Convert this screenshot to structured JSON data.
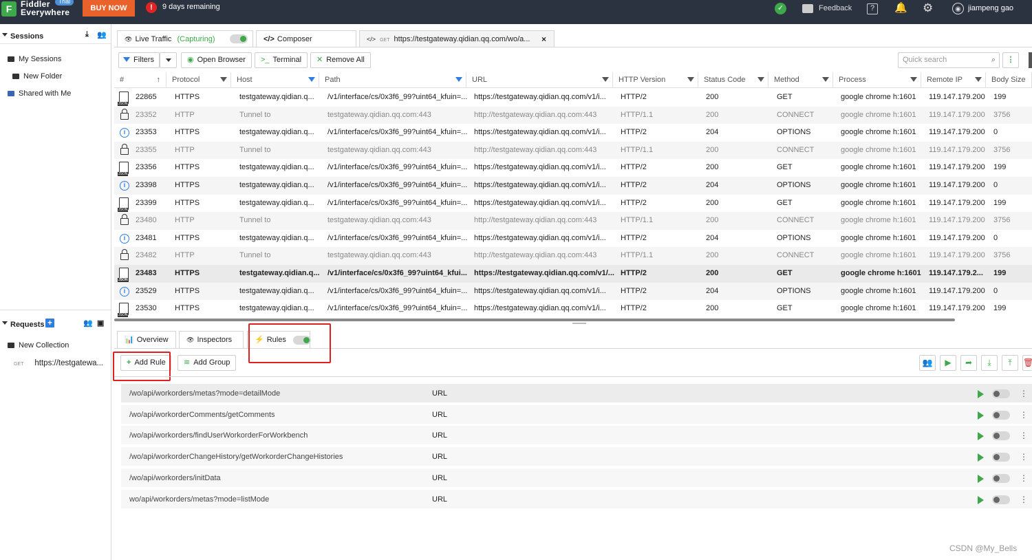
{
  "topbar": {
    "app_name_line1": "Fiddler",
    "app_name_line2": "Everywhere",
    "trial_badge": "Trial",
    "buy_now": "BUY NOW",
    "remaining": "9 days remaining",
    "feedback": "Feedback",
    "user": "jiampeng gao"
  },
  "sidebar": {
    "sessions_title": "Sessions",
    "my_sessions": "My Sessions",
    "new_folder": "New Folder",
    "shared_with_me": "Shared with Me",
    "requests_title": "Requests",
    "new_collection": "New Collection",
    "request_method": "GET",
    "request_url": "https://testgatewa..."
  },
  "tabs": {
    "live_traffic": "Live Traffic",
    "capturing": "(Capturing)",
    "composer": "Composer",
    "get_badge": "GET",
    "get_url": "https://testgateway.qidian.qq.com/wo/a..."
  },
  "toolbar": {
    "filters": "Filters",
    "open_browser": "Open Browser",
    "terminal": "Terminal",
    "remove_all": "Remove All",
    "search_placeholder": "Quick search"
  },
  "columns": [
    "#",
    "Protocol",
    "Host",
    "Path",
    "URL",
    "HTTP Version",
    "Status Code",
    "Method",
    "Process",
    "Remote IP",
    "Body Size"
  ],
  "sessions": [
    {
      "icon": "json",
      "id": "22865",
      "protocol": "HTTPS",
      "host": "testgateway.qidian.q...",
      "path": "/v1/interface/cs/0x3f6_99?uint64_kfuin=...",
      "url": "https://testgateway.qidian.qq.com/v1/i...",
      "version": "HTTP/2",
      "status": "200",
      "method": "GET",
      "process": "google chrome h:1601",
      "ip": "119.147.179.200",
      "size": "199"
    },
    {
      "icon": "lock",
      "id": "23352",
      "protocol": "HTTP",
      "host": "Tunnel to",
      "path": "testgateway.qidian.qq.com:443",
      "url": "http://testgateway.qidian.qq.com:443",
      "version": "HTTP/1.1",
      "status": "200",
      "method": "CONNECT",
      "process": "google chrome h:1601",
      "ip": "119.147.179.200",
      "size": "3756"
    },
    {
      "icon": "info",
      "id": "23353",
      "protocol": "HTTPS",
      "host": "testgateway.qidian.q...",
      "path": "/v1/interface/cs/0x3f6_99?uint64_kfuin=...",
      "url": "https://testgateway.qidian.qq.com/v1/i...",
      "version": "HTTP/2",
      "status": "204",
      "method": "OPTIONS",
      "process": "google chrome h:1601",
      "ip": "119.147.179.200",
      "size": "0"
    },
    {
      "icon": "lock",
      "id": "23355",
      "protocol": "HTTP",
      "host": "Tunnel to",
      "path": "testgateway.qidian.qq.com:443",
      "url": "http://testgateway.qidian.qq.com:443",
      "version": "HTTP/1.1",
      "status": "200",
      "method": "CONNECT",
      "process": "google chrome h:1601",
      "ip": "119.147.179.200",
      "size": "3756"
    },
    {
      "icon": "json",
      "id": "23356",
      "protocol": "HTTPS",
      "host": "testgateway.qidian.q...",
      "path": "/v1/interface/cs/0x3f6_99?uint64_kfuin=...",
      "url": "https://testgateway.qidian.qq.com/v1/i...",
      "version": "HTTP/2",
      "status": "200",
      "method": "GET",
      "process": "google chrome h:1601",
      "ip": "119.147.179.200",
      "size": "199"
    },
    {
      "icon": "info",
      "id": "23398",
      "protocol": "HTTPS",
      "host": "testgateway.qidian.q...",
      "path": "/v1/interface/cs/0x3f6_99?uint64_kfuin=...",
      "url": "https://testgateway.qidian.qq.com/v1/i...",
      "version": "HTTP/2",
      "status": "204",
      "method": "OPTIONS",
      "process": "google chrome h:1601",
      "ip": "119.147.179.200",
      "size": "0"
    },
    {
      "icon": "json",
      "id": "23399",
      "protocol": "HTTPS",
      "host": "testgateway.qidian.q...",
      "path": "/v1/interface/cs/0x3f6_99?uint64_kfuin=...",
      "url": "https://testgateway.qidian.qq.com/v1/i...",
      "version": "HTTP/2",
      "status": "200",
      "method": "GET",
      "process": "google chrome h:1601",
      "ip": "119.147.179.200",
      "size": "199"
    },
    {
      "icon": "lock",
      "id": "23480",
      "protocol": "HTTP",
      "host": "Tunnel to",
      "path": "testgateway.qidian.qq.com:443",
      "url": "http://testgateway.qidian.qq.com:443",
      "version": "HTTP/1.1",
      "status": "200",
      "method": "CONNECT",
      "process": "google chrome h:1601",
      "ip": "119.147.179.200",
      "size": "3756"
    },
    {
      "icon": "info",
      "id": "23481",
      "protocol": "HTTPS",
      "host": "testgateway.qidian.q...",
      "path": "/v1/interface/cs/0x3f6_99?uint64_kfuin=...",
      "url": "https://testgateway.qidian.qq.com/v1/i...",
      "version": "HTTP/2",
      "status": "204",
      "method": "OPTIONS",
      "process": "google chrome h:1601",
      "ip": "119.147.179.200",
      "size": "0"
    },
    {
      "icon": "lock",
      "id": "23482",
      "protocol": "HTTP",
      "host": "Tunnel to",
      "path": "testgateway.qidian.qq.com:443",
      "url": "http://testgateway.qidian.qq.com:443",
      "version": "HTTP/1.1",
      "status": "200",
      "method": "CONNECT",
      "process": "google chrome h:1601",
      "ip": "119.147.179.200",
      "size": "3756"
    },
    {
      "icon": "json",
      "id": "23483",
      "protocol": "HTTPS",
      "host": "testgateway.qidian.q...",
      "path": "/v1/interface/cs/0x3f6_99?uint64_kfui...",
      "url": "https://testgateway.qidian.qq.com/v1/...",
      "version": "HTTP/2",
      "status": "200",
      "method": "GET",
      "process": "google chrome h:1601",
      "ip": "119.147.179.2...",
      "size": "199"
    },
    {
      "icon": "info",
      "id": "23529",
      "protocol": "HTTPS",
      "host": "testgateway.qidian.q...",
      "path": "/v1/interface/cs/0x3f6_99?uint64_kfuin=...",
      "url": "https://testgateway.qidian.qq.com/v1/i...",
      "version": "HTTP/2",
      "status": "204",
      "method": "OPTIONS",
      "process": "google chrome h:1601",
      "ip": "119.147.179.200",
      "size": "0"
    },
    {
      "icon": "json",
      "id": "23530",
      "protocol": "HTTPS",
      "host": "testgateway.qidian.q...",
      "path": "/v1/interface/cs/0x3f6_99?uint64_kfuin=...",
      "url": "https://testgateway.qidian.qq.com/v1/i...",
      "version": "HTTP/2",
      "status": "200",
      "method": "GET",
      "process": "google chrome h:1601",
      "ip": "119.147.179.200",
      "size": "199"
    }
  ],
  "bottom_tabs": {
    "overview": "Overview",
    "inspectors": "Inspectors",
    "rules": "Rules"
  },
  "rules_toolbar": {
    "add_rule": "Add Rule",
    "add_group": "Add Group"
  },
  "rules": [
    {
      "path": "/wo/api/workorders/metas?mode=detailMode",
      "type": "URL"
    },
    {
      "path": "/wo/api/workorderComments/getComments",
      "type": "URL"
    },
    {
      "path": "/wo/api/workorders/findUserWorkorderForWorkbench",
      "type": "URL"
    },
    {
      "path": "/wo/api/workorderChangeHistory/getWorkorderChangeHistories",
      "type": "URL"
    },
    {
      "path": "/wo/api/workorders/initData",
      "type": "URL"
    },
    {
      "path": "wo/api/workorders/metas?mode=listMode",
      "type": "URL"
    }
  ],
  "watermark": "CSDN @My_Bells",
  "colors": {
    "brand_green": "#3fa84a",
    "buy_orange": "#e9622b",
    "topbar": "#2c3340",
    "filter_blue": "#2f7de1",
    "highlight_red": "#e02020"
  }
}
